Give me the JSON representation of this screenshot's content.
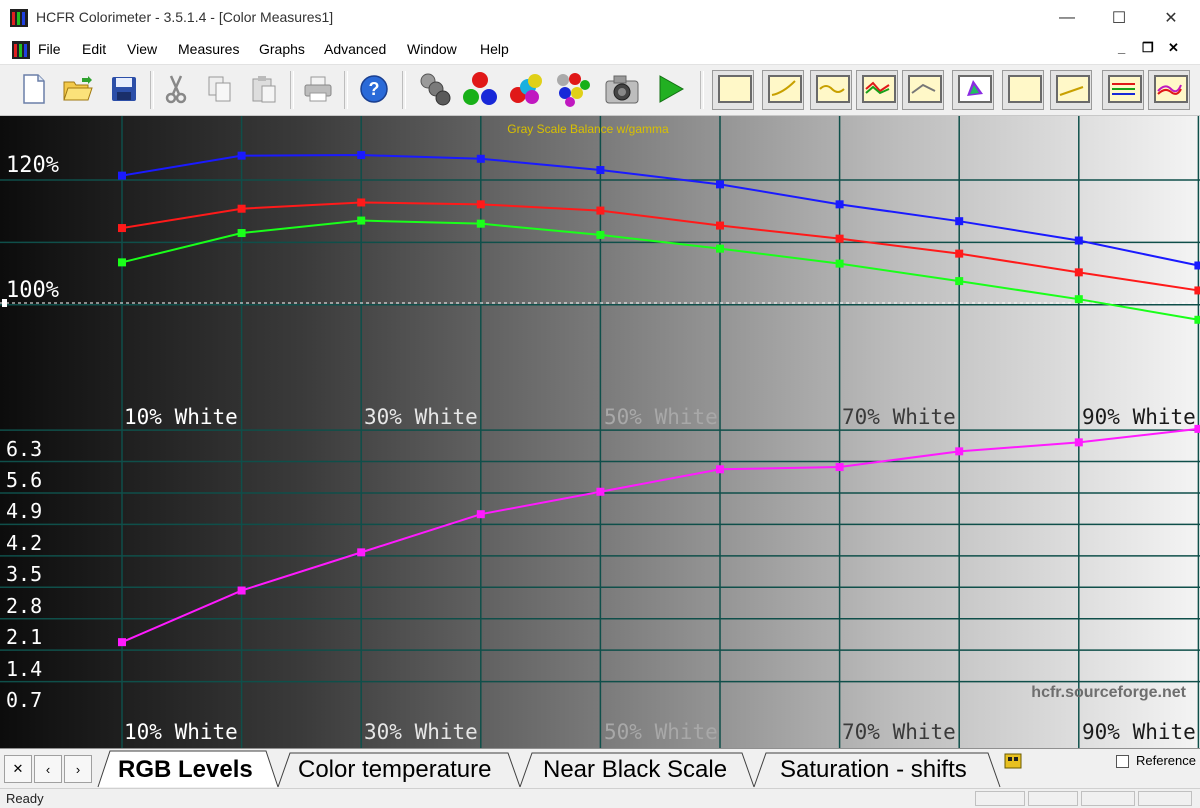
{
  "window": {
    "title": "HCFR Colorimeter - 3.5.1.4 - [Color Measures1]"
  },
  "window_controls": {
    "minimize": "—",
    "maximize": "☐",
    "close": "✕"
  },
  "menu": [
    "File",
    "Edit",
    "View",
    "Measures",
    "Graphs",
    "Advanced",
    "Window",
    "Help"
  ],
  "mdi_controls": {
    "minimize": "_",
    "restore": "❐",
    "close": "✕"
  },
  "toolbar": {
    "buttons": [
      "new-document-icon",
      "open-folder-icon",
      "save-icon",
      "cut-icon",
      "copy-icon",
      "paste-icon",
      "print-icon",
      "help-icon",
      "sensor-probe-icon",
      "rgb-balls-icon",
      "color-balls-icon",
      "multi-color-balls-icon",
      "camera-icon",
      "play-icon"
    ],
    "graph_buttons": [
      "graph-view-1",
      "graph-view-2",
      "graph-view-3",
      "graph-view-4",
      "graph-view-5",
      "cie-chart-view",
      "graph-view-7",
      "graph-view-8",
      "graph-view-9",
      "graph-view-10"
    ]
  },
  "colors": {
    "red": "#ff1a1a",
    "green": "#1aff1a",
    "blue": "#1a1aff",
    "magenta": "#ff1aff",
    "grid": "#0f4f4a",
    "title": "#d8c000"
  },
  "chart_data": [
    {
      "type": "line",
      "title": "Gray Scale Balance w/gamma",
      "x": [
        10,
        20,
        30,
        40,
        50,
        60,
        70,
        80,
        90,
        100
      ],
      "x_tick_labels": [
        "10% White",
        "30% White",
        "50% White",
        "70% White",
        "90% White"
      ],
      "y_tick_labels": [
        "120%",
        "100%"
      ],
      "reference_line": 100,
      "series": [
        {
          "color": "blue",
          "values": [
            120.7,
            123.9,
            124.0,
            123.4,
            121.6,
            119.3,
            116.1,
            113.4,
            110.3,
            106.3
          ]
        },
        {
          "color": "red",
          "values": [
            112.3,
            115.4,
            116.4,
            116.1,
            115.1,
            112.7,
            110.6,
            108.2,
            105.2,
            102.3
          ]
        },
        {
          "color": "green",
          "values": [
            106.8,
            111.5,
            113.5,
            113.0,
            111.2,
            109.0,
            106.6,
            103.8,
            100.9,
            97.6
          ]
        }
      ]
    },
    {
      "type": "line",
      "x": [
        10,
        20,
        30,
        40,
        50,
        60,
        70,
        80,
        90,
        100
      ],
      "x_tick_labels": [
        "10% White",
        "30% White",
        "50% White",
        "70% White",
        "90% White"
      ],
      "y_tick_labels": [
        "6.3",
        "5.6",
        "4.9",
        "4.2",
        "3.5",
        "2.8",
        "2.1",
        "1.4",
        "0.7"
      ],
      "series": [
        {
          "color": "magenta",
          "values": [
            1.6,
            2.75,
            3.6,
            4.45,
            4.95,
            5.45,
            5.5,
            5.85,
            6.05,
            6.35
          ]
        }
      ]
    }
  ],
  "watermark": "hcfr.sourceforge.net",
  "tabs": [
    "RGB Levels",
    "Color temperature",
    "Near Black Scale",
    "Saturation - shifts"
  ],
  "tab_nav": [
    "✕",
    "‹",
    "›"
  ],
  "reference_label": "Reference",
  "status": "Ready"
}
